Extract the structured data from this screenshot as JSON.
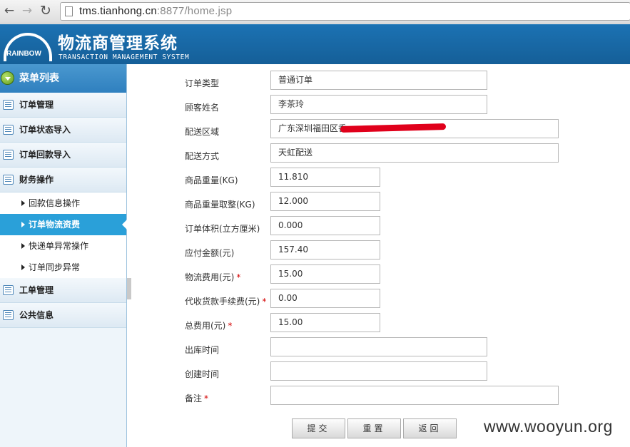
{
  "browser": {
    "back_icon": "back-arrow-icon",
    "forward_icon": "forward-arrow-icon",
    "reload_icon": "reload-icon",
    "url_domain": "tms.tianhong.cn",
    "url_rest": ":8877/home.jsp"
  },
  "header": {
    "logo_text": "RAINBOW",
    "title": "物流商管理系统",
    "subtitle": "TRANSACTION MANAGEMENT SYSTEM"
  },
  "sidebar": {
    "heading": "菜单列表",
    "items": [
      {
        "label": "订单管理"
      },
      {
        "label": "订单状态导入"
      },
      {
        "label": "订单回款导入"
      },
      {
        "label": "财务操作"
      }
    ],
    "subitems": [
      {
        "label": "回款信息操作"
      },
      {
        "label": "订单物流资费",
        "active": true
      },
      {
        "label": "快递单异常操作"
      },
      {
        "label": "订单同步异常"
      }
    ],
    "items_after": [
      {
        "label": "工单管理"
      },
      {
        "label": "公共信息"
      }
    ]
  },
  "form": {
    "order_type": {
      "label": "订单类型",
      "value": "普通订单"
    },
    "customer_name": {
      "label": "顾客姓名",
      "value": "李茶玲"
    },
    "delivery_area": {
      "label": "配送区域",
      "value": "广东深圳福田区香"
    },
    "delivery_method": {
      "label": "配送方式",
      "value": "天虹配送"
    },
    "weight": {
      "label": "商品重量(KG)",
      "value": "11.810"
    },
    "weight_rounded": {
      "label": "商品重量取整(KG)",
      "value": "12.000"
    },
    "volume": {
      "label": "订单体积(立方厘米)",
      "value": "0.000"
    },
    "amount_due": {
      "label": "应付金额(元)",
      "value": "157.40"
    },
    "logistics_fee": {
      "label": "物流费用(元)",
      "value": "15.00",
      "required": "*"
    },
    "cod_fee": {
      "label": "代收货款手续费(元)",
      "value": "0.00",
      "required": "*"
    },
    "total_fee": {
      "label": "总费用(元)",
      "value": "15.00",
      "required": "*"
    },
    "outbound_time": {
      "label": "出库时间",
      "value": ""
    },
    "created_time": {
      "label": "创建时间",
      "value": ""
    },
    "remark": {
      "label": "备注",
      "value": "",
      "required": "*"
    }
  },
  "buttons": {
    "submit": "提交",
    "reset": "重置",
    "back": "返回"
  },
  "watermark": "www.wooyun.org",
  "colors": {
    "header_blue": "#1c72b3",
    "active_item": "#2aa0d9",
    "required": "#d40000"
  }
}
